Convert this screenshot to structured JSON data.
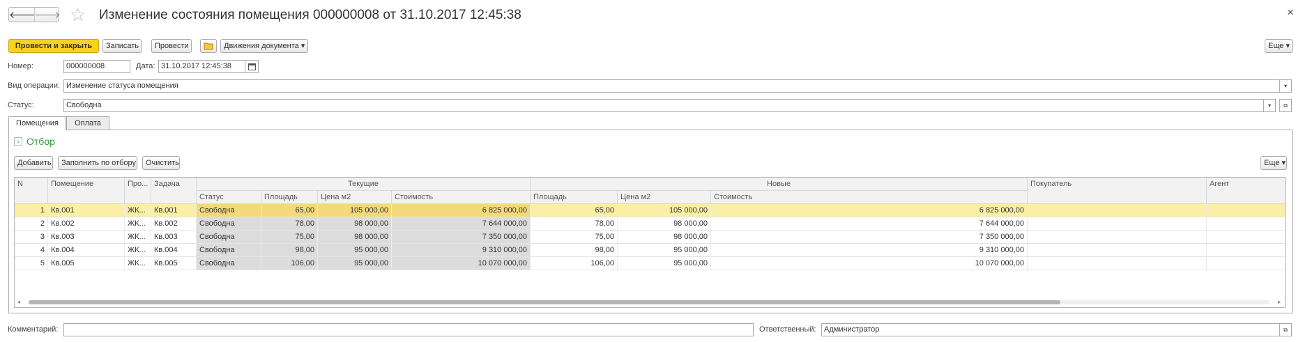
{
  "window": {
    "title": "Изменение состояния помещения 000000008 от 31.10.2017 12:45:38",
    "back_glyph": "🡐",
    "forward_glyph": "🡒",
    "star_glyph": "☆",
    "close_glyph": "×"
  },
  "toolbar": {
    "post_close": "Провести и закрыть",
    "save": "Записать",
    "post": "Провести",
    "movements": "Движения документа ▾",
    "more": "Еще ▾"
  },
  "form": {
    "number_label": "Номер:",
    "number_value": "000000008",
    "date_label": "Дата:",
    "date_value": "31.10.2017 12:45:38",
    "op_label": "Вид операции:",
    "op_value": "Изменение статуса помещения",
    "status_label": "Статус:",
    "status_value": "Свободна",
    "comment_label": "Комментарий:",
    "comment_value": "",
    "responsible_label": "Ответственный:",
    "responsible_value": "Администратор"
  },
  "tabs": [
    {
      "label": "Помещения"
    },
    {
      "label": "Оплата"
    }
  ],
  "filter": {
    "label": "Отбор"
  },
  "table_toolbar": {
    "add": "Добавить",
    "fill": "Заполнить по отбору",
    "clear": "Очистить",
    "more": "Еще ▾"
  },
  "table": {
    "headers": {
      "n": "N",
      "room": "Помещение",
      "proj": "Про...",
      "task": "Задача",
      "current": "Текущие",
      "new": "Новые",
      "buyer": "Покупатель",
      "agent": "Агент",
      "cur_status": "Статус",
      "cur_area": "Площадь",
      "cur_price": "Цена м2",
      "cur_cost": "Стоимость",
      "new_area": "Площадь",
      "new_price": "Цена м2",
      "new_cost": "Стоимость"
    },
    "rows": [
      {
        "n": "1",
        "room": "Кв.001",
        "proj": "ЖК...",
        "task": "Кв.001",
        "status": "Свободна",
        "area": "65,00",
        "price": "105 000,00",
        "cost": "6 825 000,00",
        "new_area": "65,00",
        "new_price": "105 000,00",
        "new_cost": "6 825 000,00"
      },
      {
        "n": "2",
        "room": "Кв.002",
        "proj": "ЖК...",
        "task": "Кв.002",
        "status": "Свободна",
        "area": "78,00",
        "price": "98 000,00",
        "cost": "7 644 000,00",
        "new_area": "78,00",
        "new_price": "98 000,00",
        "new_cost": "7 644 000,00"
      },
      {
        "n": "3",
        "room": "Кв.003",
        "proj": "ЖК...",
        "task": "Кв.003",
        "status": "Свободна",
        "area": "75,00",
        "price": "98 000,00",
        "cost": "7 350 000,00",
        "new_area": "75,00",
        "new_price": "98 000,00",
        "new_cost": "7 350 000,00"
      },
      {
        "n": "4",
        "room": "Кв.004",
        "proj": "ЖК...",
        "task": "Кв.004",
        "status": "Свободна",
        "area": "98,00",
        "price": "95 000,00",
        "cost": "9 310 000,00",
        "new_area": "98,00",
        "new_price": "95 000,00",
        "new_cost": "9 310 000,00"
      },
      {
        "n": "5",
        "room": "Кв.005",
        "proj": "ЖК...",
        "task": "Кв.005",
        "status": "Свободна",
        "area": "106,00",
        "price": "95 000,00",
        "cost": "10 070 000,00",
        "new_area": "106,00",
        "new_price": "95 000,00",
        "new_cost": "10 070 000,00"
      }
    ]
  },
  "colors": {
    "accent": "#f8d21f",
    "selected_row": "#fbeea6",
    "filter_green": "#2e9a3b"
  }
}
